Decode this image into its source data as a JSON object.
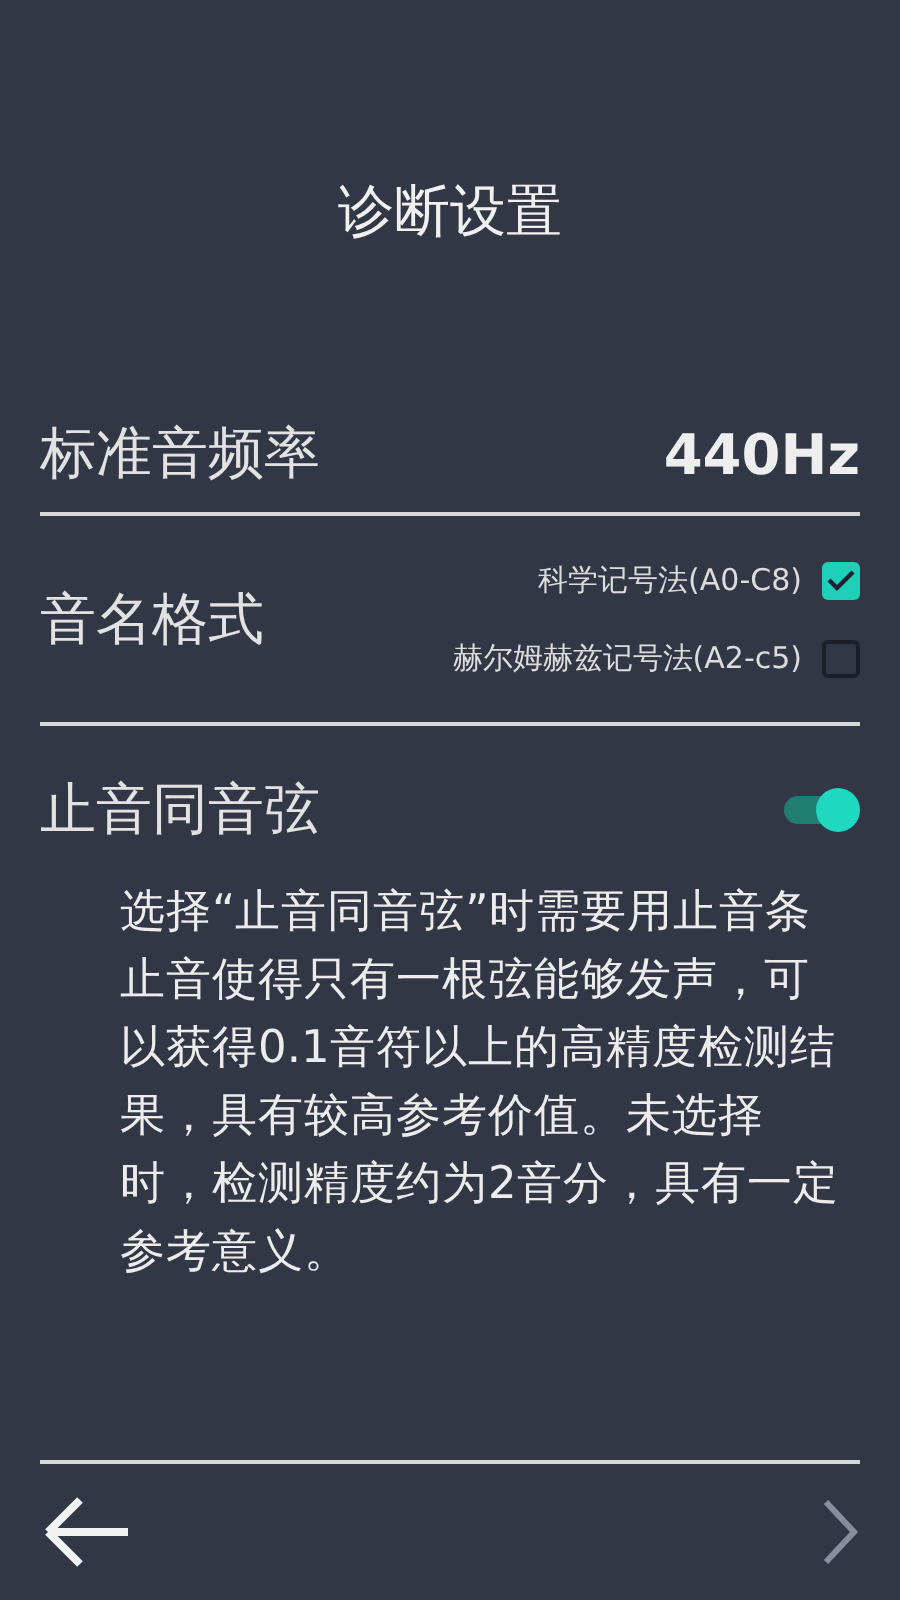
{
  "title": "诊断设置",
  "frequency": {
    "label": "标准音频率",
    "value": "440Hz"
  },
  "note_format": {
    "label": "音名格式",
    "options": [
      {
        "label": "科学记号法(A0-C8)",
        "checked": true
      },
      {
        "label": "赫尔姆赫兹记号法(A2-c5)",
        "checked": false
      }
    ]
  },
  "muted_string": {
    "label": "止音同音弦",
    "on": true,
    "description": "选择“止音同音弦”时需要用止音条止音使得只有一根弦能够发声，可以获得0.1音符以上的高精度检测结果，具有较高参考价值。未选择时，检测精度约为2音分，具有一定参考意义。"
  }
}
